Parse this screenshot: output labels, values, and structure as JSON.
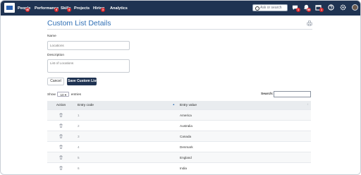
{
  "nav": {
    "items": [
      {
        "label": "People",
        "badge": "46"
      },
      {
        "label": "Performance",
        "badge": "5"
      },
      {
        "label": "Skills",
        "badge": "4"
      },
      {
        "label": "Projects",
        "badge": ""
      },
      {
        "label": "Hiring",
        "badge": "3"
      },
      {
        "label": "Analytics",
        "badge": ""
      }
    ],
    "search_placeholder": "Ask or search",
    "icon_badges": {
      "chat": "1",
      "bell": "86",
      "calendar": "1"
    },
    "colors": {
      "bar": "#1f3352",
      "badge": "#d7262b"
    }
  },
  "page": {
    "title": "Custom List Details",
    "name_label": "Name",
    "name_value": "Locations",
    "description_label": "Description",
    "description_value": "List of Locations",
    "cancel_label": "Cancel",
    "save_label": "Save Custom List"
  },
  "table_controls": {
    "show_prefix": "Show",
    "page_size": "10",
    "show_suffix": "entries",
    "search_label": "Search:"
  },
  "table": {
    "headers": [
      "Action",
      "Entry code",
      "Entry value"
    ],
    "rows": [
      {
        "code": "1",
        "value": "America"
      },
      {
        "code": "2",
        "value": "Australia"
      },
      {
        "code": "3",
        "value": "Canada"
      },
      {
        "code": "4",
        "value": "Denmark"
      },
      {
        "code": "5",
        "value": "England"
      },
      {
        "code": "6",
        "value": "India"
      }
    ]
  }
}
